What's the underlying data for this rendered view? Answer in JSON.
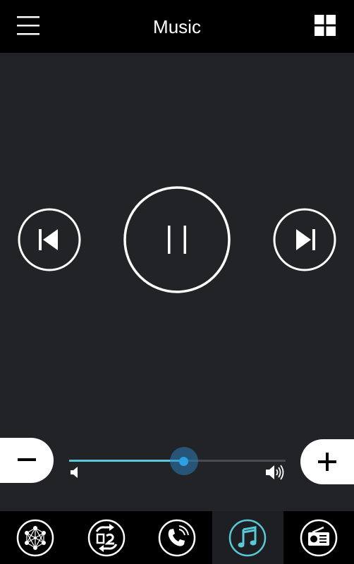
{
  "header": {
    "title": "Music",
    "menu_icon": "hamburger-menu-icon",
    "grid_icon": "grid-view-icon"
  },
  "player": {
    "previous_icon": "skip-previous-icon",
    "state": "playing",
    "pause_icon": "pause-icon",
    "next_icon": "skip-next-icon"
  },
  "volume": {
    "level": 0.53,
    "minus_label": "−",
    "plus_label": "+",
    "low_icon": "volume-low-icon",
    "high_icon": "volume-high-icon"
  },
  "bottom_nav": {
    "active_index": 3,
    "items": [
      {
        "icon": "network-icon"
      },
      {
        "icon": "swap-icon"
      },
      {
        "icon": "phone-call-icon"
      },
      {
        "icon": "music-note-icon"
      },
      {
        "icon": "radio-icon"
      }
    ]
  },
  "colors": {
    "background": "#222326",
    "bar_background": "#000000",
    "accent": "#59c9d9",
    "slider_thumb": "#2ca0e0",
    "foreground": "#ffffff"
  }
}
